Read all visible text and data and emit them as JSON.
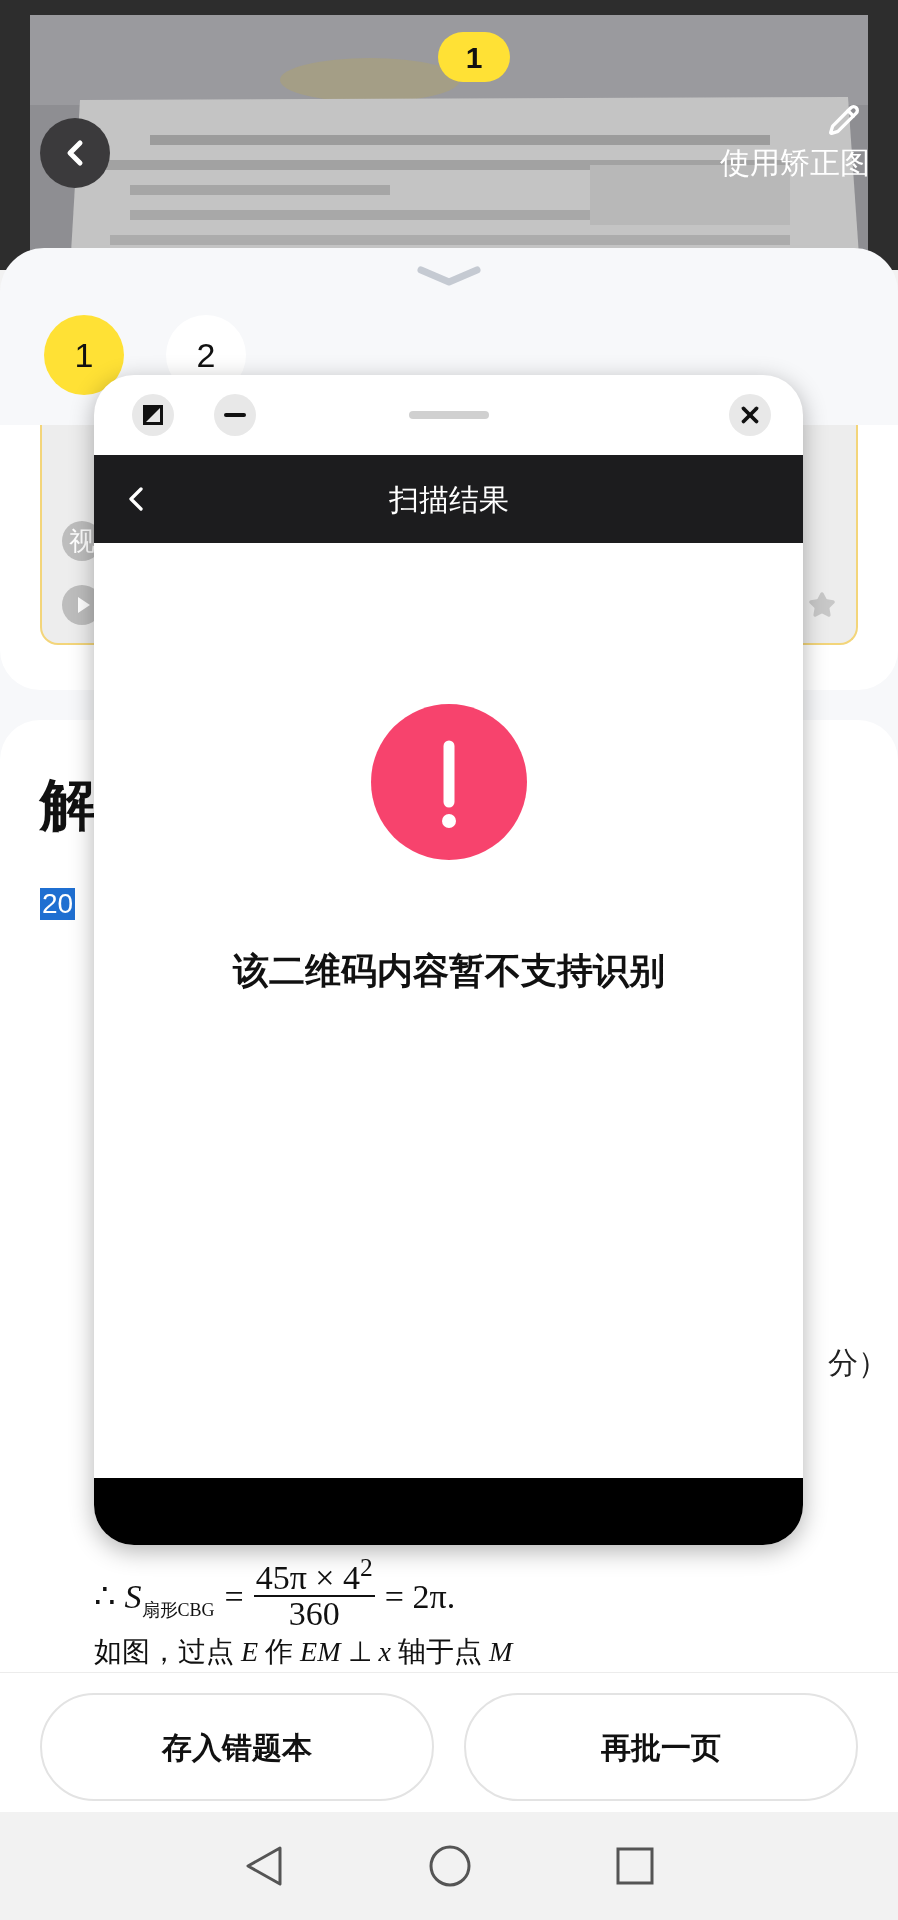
{
  "photo_header": {
    "kind": "picture",
    "page_badge": "1",
    "correction_label": "使用矫正图"
  },
  "sheet": {
    "page_tabs": [
      {
        "label": "1",
        "selected": true
      },
      {
        "label": "2",
        "selected": false
      }
    ],
    "card": {
      "chip": "视"
    },
    "solution": {
      "heading": "解",
      "question_number": "20",
      "score_fragment": "分）",
      "formula": {
        "lead": "∴ *S*",
        "subscript": "扇形CBG",
        "equals": "=",
        "numerator": "45π × 4$^{2}$",
        "denominator": "360",
        "result": "= 2π."
      },
      "next_line": "如图，过点 *E* 作 *EM* ⊥ *x* 轴于点 *M*"
    }
  },
  "dialog": {
    "title": "扫描结果",
    "message": "该二维码内容暂不支持识别"
  },
  "actions": [
    "存入错题本",
    "再批一页"
  ]
}
